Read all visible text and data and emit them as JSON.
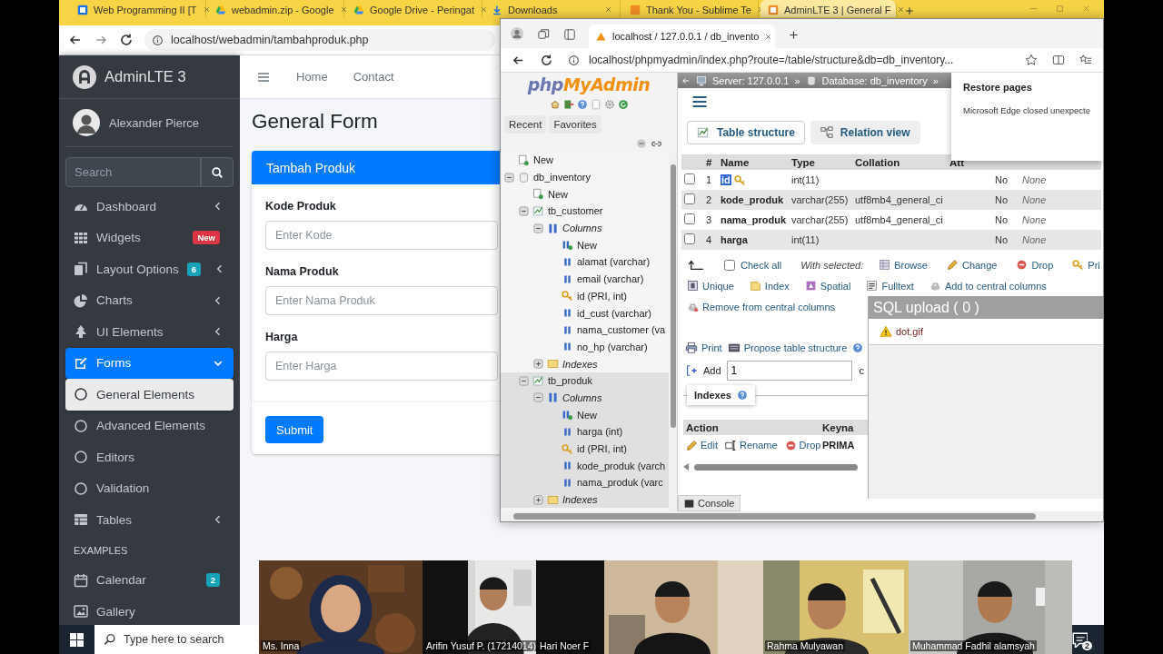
{
  "browser": {
    "tabs": [
      {
        "label": "Web Programming II [T",
        "selected": false
      },
      {
        "label": "webadmin.zip - Google",
        "selected": false
      },
      {
        "label": "Google Drive - Peringat",
        "selected": false
      },
      {
        "label": "Downloads",
        "selected": false
      },
      {
        "label": "Thank You - Sublime Te",
        "selected": false
      },
      {
        "label": "AdminLTE 3 | General F",
        "selected": true
      }
    ],
    "url": "localhost/webadmin/tambahproduk.php"
  },
  "adminlte": {
    "brand": "AdminLTE 3",
    "user": "Alexander Pierce",
    "search": {
      "placeholder": "Search"
    },
    "nav": [
      {
        "kind": "item",
        "label": "Dashboard",
        "selected": false,
        "expanded": false
      },
      {
        "kind": "item",
        "label": "Widgets",
        "selected": false,
        "badge": {
          "text": "New",
          "color": "#dc3545"
        }
      },
      {
        "kind": "item",
        "label": "Layout Options",
        "selected": false,
        "expanded": false,
        "badge": {
          "text": "6",
          "color": "#17a2b8"
        }
      },
      {
        "kind": "item",
        "label": "Charts",
        "selected": false,
        "expanded": false
      },
      {
        "kind": "item",
        "label": "UI Elements",
        "selected": false,
        "expanded": false
      },
      {
        "kind": "item",
        "label": "Forms",
        "selected": true,
        "expanded": true
      },
      {
        "kind": "subitem",
        "label": "General Elements",
        "selected": true
      },
      {
        "kind": "subitem",
        "label": "Advanced Elements",
        "selected": false
      },
      {
        "kind": "subitem",
        "label": "Editors",
        "selected": false
      },
      {
        "kind": "subitem",
        "label": "Validation",
        "selected": false
      },
      {
        "kind": "item",
        "label": "Tables",
        "selected": false,
        "expanded": false
      },
      {
        "kind": "header",
        "label": "EXAMPLES"
      },
      {
        "kind": "item",
        "label": "Calendar",
        "selected": false,
        "badge": {
          "text": "2",
          "color": "#17a2b8"
        }
      },
      {
        "kind": "item",
        "label": "Gallery",
        "selected": false
      }
    ],
    "navbar": [
      "Home",
      "Contact"
    ],
    "page_title": "General Form",
    "card": {
      "title": "Tambah Produk",
      "fields": [
        {
          "label": "Kode Produk",
          "placeholder": "Enter Kode"
        },
        {
          "label": "Nama Produk",
          "placeholder": "Enter Nama Produk"
        },
        {
          "label": "Harga",
          "placeholder": "Enter Harga"
        }
      ],
      "submit": "Submit"
    }
  },
  "phpmyadmin_window": {
    "tabs": [
      {
        "label": "localhost / 127.0.0.1 / db_invento",
        "selected": true
      }
    ],
    "url": "localhost/phpmyadmin/index.php?route=/table/structure&db=db_inventory...",
    "nav": {
      "logo_prefix": "php",
      "logo_rest": "MyAdmin",
      "tabs": [
        {
          "label": "Recent",
          "selected": false
        },
        {
          "label": "Favorites",
          "selected": false
        }
      ],
      "tree": [
        {
          "kind": "new",
          "label": "New"
        },
        {
          "kind": "database",
          "label": "db_inventory",
          "expanded": true,
          "children": [
            {
              "kind": "new",
              "label": "New"
            },
            {
              "kind": "table",
              "label": "tb_customer",
              "expanded": true,
              "selected": false,
              "children": [
                {
                  "kind": "group",
                  "label": "Columns",
                  "expanded": true,
                  "children": [
                    {
                      "kind": "new_column",
                      "label": "New"
                    },
                    {
                      "kind": "column",
                      "label": "alamat (varchar)"
                    },
                    {
                      "kind": "column",
                      "label": "email (varchar)"
                    },
                    {
                      "kind": "key",
                      "label": "id (PRI, int)"
                    },
                    {
                      "kind": "column",
                      "label": "id_cust (varchar)"
                    },
                    {
                      "kind": "column",
                      "label": "nama_customer (va"
                    },
                    {
                      "kind": "column",
                      "label": "no_hp (varchar)"
                    }
                  ]
                },
                {
                  "kind": "indexes",
                  "label": "Indexes",
                  "expanded": false
                }
              ]
            },
            {
              "kind": "table",
              "label": "tb_produk",
              "expanded": true,
              "selected": true,
              "children": [
                {
                  "kind": "group",
                  "label": "Columns",
                  "expanded": true,
                  "children": [
                    {
                      "kind": "new_column",
                      "label": "New"
                    },
                    {
                      "kind": "column",
                      "label": "harga (int)"
                    },
                    {
                      "kind": "key",
                      "label": "id (PRI, int)"
                    },
                    {
                      "kind": "column",
                      "label": "kode_produk (varch"
                    },
                    {
                      "kind": "column",
                      "label": "nama_produk (varc"
                    }
                  ]
                },
                {
                  "kind": "indexes",
                  "label": "Indexes",
                  "expanded": false
                }
              ]
            }
          ]
        }
      ]
    },
    "breadcrumb": {
      "items": [
        "Server: 127.0.0.1",
        "Database: db_inventory"
      ],
      "separator": "»"
    },
    "view_tabs": [
      {
        "label": "Table structure",
        "selected": true
      },
      {
        "label": "Relation view",
        "selected": false
      }
    ],
    "columns": [
      "#",
      "Name",
      "Type",
      "Collation",
      "Att"
    ],
    "rows": [
      {
        "num": "1",
        "name": "id",
        "type": "int(11)",
        "null": "No",
        "default": "None",
        "checked": false,
        "primary": true,
        "highlighted": true
      },
      {
        "num": "2",
        "name": "kode_produk",
        "type": "varchar(255)",
        "collation": "utf8mb4_general_ci",
        "null": "No",
        "default": "None",
        "checked": false,
        "primary": false,
        "highlighted": false
      },
      {
        "num": "3",
        "name": "nama_produk",
        "type": "varchar(255)",
        "collation": "utf8mb4_general_ci",
        "null": "No",
        "default": "None",
        "checked": false,
        "primary": false,
        "highlighted": false
      },
      {
        "num": "4",
        "name": "harga",
        "type": "int(11)",
        "null": "No",
        "default": "None",
        "checked": false,
        "primary": false,
        "highlighted": false
      }
    ],
    "check_all": {
      "label": "Check all",
      "checked": false
    },
    "with_selected": "With selected:",
    "bulk_action_rows": [
      [
        "Browse",
        "Change",
        "Drop",
        "Pri"
      ],
      [
        "Unique",
        "Index",
        "Spatial",
        "Fulltext",
        "Add to central columns"
      ],
      [
        "Remove from central columns"
      ]
    ],
    "tools": [
      "Print",
      "Propose table structure"
    ],
    "add": {
      "label": "Add",
      "value": "1",
      "suffix": "c"
    },
    "indexes": {
      "legend": "Indexes",
      "columns": [
        "Action",
        "Keyna"
      ],
      "row_actions": [
        "Edit",
        "Rename",
        "Drop"
      ],
      "keyname": "PRIMA"
    },
    "console": "Console",
    "restore_popup": {
      "title": "Restore pages",
      "message": "Microsoft Edge closed unexpecte"
    },
    "sql_upload": {
      "title": "SQL upload ( 0 )",
      "files": [
        "dot.gif"
      ]
    }
  },
  "meeting": {
    "participants": [
      {
        "name": "Ms. Inna"
      },
      {
        "name": "Arifin Yusuf P. (17214014)"
      },
      {
        "name": "Hari Noer F"
      },
      {
        "name": "Rahma Mulyawan"
      },
      {
        "name": "Muhammad Fadhil alamsyah"
      }
    ]
  },
  "taskbar": {
    "search_placeholder": "Type here to search",
    "notifications": "2"
  }
}
